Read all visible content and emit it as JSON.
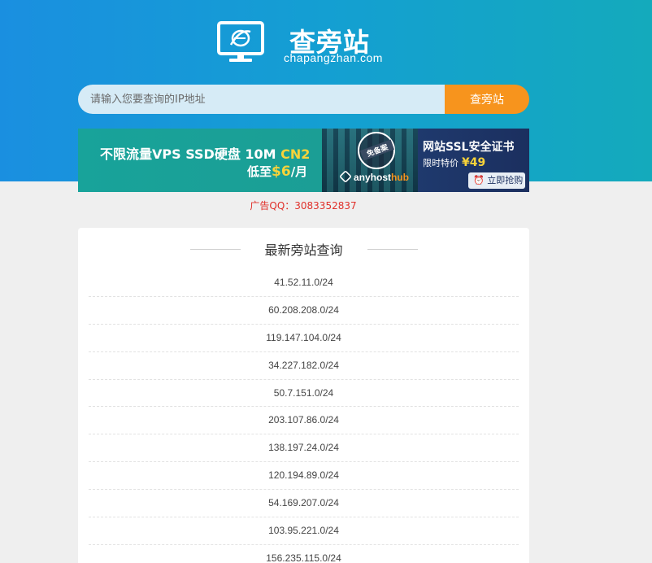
{
  "header": {
    "logo_title": "查旁站",
    "logo_subtitle": "chapangzhan.com"
  },
  "search": {
    "placeholder": "请输入您要查询的IP地址",
    "button_label": "查旁站"
  },
  "banner": {
    "line1_prefix": "不限流量VPS SSD硬盘 10M ",
    "line1_highlight": "CN2",
    "line2_prefix": "低至",
    "line2_price": "$6",
    "line2_suffix": "/月",
    "seal_text": "免备案",
    "brand_main": "anyhost",
    "brand_accent": "hub",
    "ssl_title": "网站SSL安全证书",
    "ssl_sub": "限时特价",
    "ssl_price": "¥49",
    "ssl_button": "立即抢购"
  },
  "ad_contact": "广告QQ：3083352837",
  "recent": {
    "title": "最新旁站查询",
    "items": [
      "41.52.11.0/24",
      "60.208.208.0/24",
      "119.147.104.0/24",
      "34.227.182.0/24",
      "50.7.151.0/24",
      "203.107.86.0/24",
      "138.197.24.0/24",
      "120.194.89.0/24",
      "54.169.207.0/24",
      "103.95.221.0/24",
      "156.235.115.0/24"
    ]
  },
  "colors": {
    "hero_gradient_start": "#1a8fe0",
    "hero_gradient_end": "#14aabc",
    "search_button": "#f7941d",
    "ad_text": "#e0302a"
  }
}
